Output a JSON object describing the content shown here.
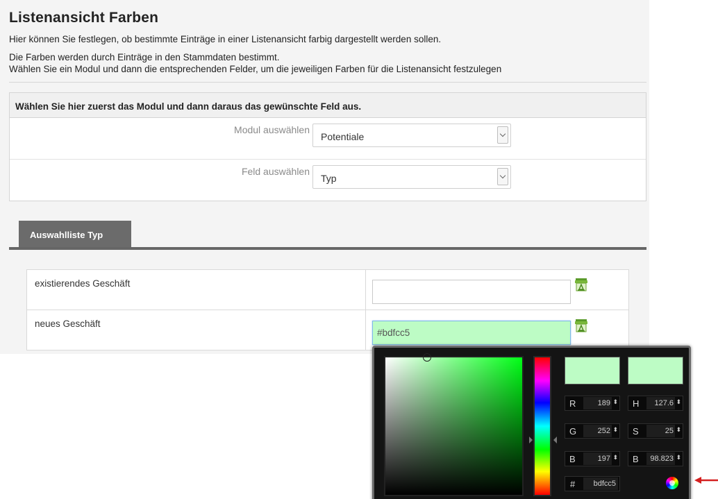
{
  "page": {
    "title": "Listenansicht Farben",
    "description_line1": "Hier können Sie festlegen, ob bestimmte Einträge in einer Listenansicht farbig dargestellt werden sollen.",
    "description_line2": "Die Farben werden durch Einträge in den Stammdaten bestimmt.",
    "description_line3": "Wählen Sie ein Modul und dann die entsprechenden Felder, um die jeweiligen Farben für die Listenansicht festzulegen"
  },
  "selection": {
    "header": "Wählen Sie hier zuerst das Modul und dann daraus das gewünschte Feld aus.",
    "module_label": "Modul auswählen",
    "module_value": "Potentiale",
    "field_label": "Feld auswählen",
    "field_value": "Typ"
  },
  "tab": {
    "label": "Auswahlliste Typ"
  },
  "color_rows": [
    {
      "label": "existierendes Geschäft",
      "value": ""
    },
    {
      "label": "neues Geschäft",
      "value": "#bdfcc5"
    }
  ],
  "color_picker": {
    "current_color": "#bdfcc5",
    "r": "189",
    "g": "252",
    "b": "197",
    "h": "127.6",
    "s": "25",
    "v": "98.823",
    "r_label": "R",
    "g_label": "G",
    "b_label": "B",
    "h_label": "H",
    "s_label": "S",
    "v_label": "B",
    "hex_label": "#",
    "hex": "bdfcc5"
  },
  "colors": {
    "tab_bg": "#6b6b6b",
    "highlight": "#bdfcc5",
    "annotation_arrow": "#d42020"
  },
  "icons": {
    "clear": "clear-color-icon",
    "wheel": "color-wheel-icon",
    "dropdown": "chevron-down-icon"
  }
}
